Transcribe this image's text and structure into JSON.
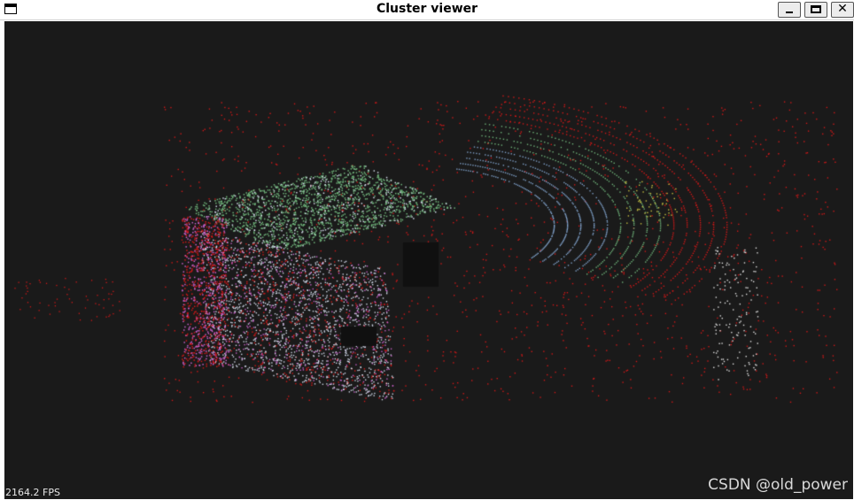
{
  "window": {
    "title": "Cluster viewer",
    "controls": [
      "minimize",
      "maximize",
      "close"
    ],
    "close_glyph": "✕"
  },
  "viewport": {
    "background": "#1a1a1a",
    "fps_text": "2164.2 FPS",
    "watermark": "CSDN @old_power"
  },
  "point_colors": {
    "noise": "#d01818",
    "roof_cluster": "#6fb37a",
    "wall_cluster": "#cfd6e6",
    "ground_ring": "#7fa0c8",
    "magenta_cluster": "#c860c8",
    "yellow_cluster": "#c8c040",
    "white_pole": "#e0e0e0"
  }
}
